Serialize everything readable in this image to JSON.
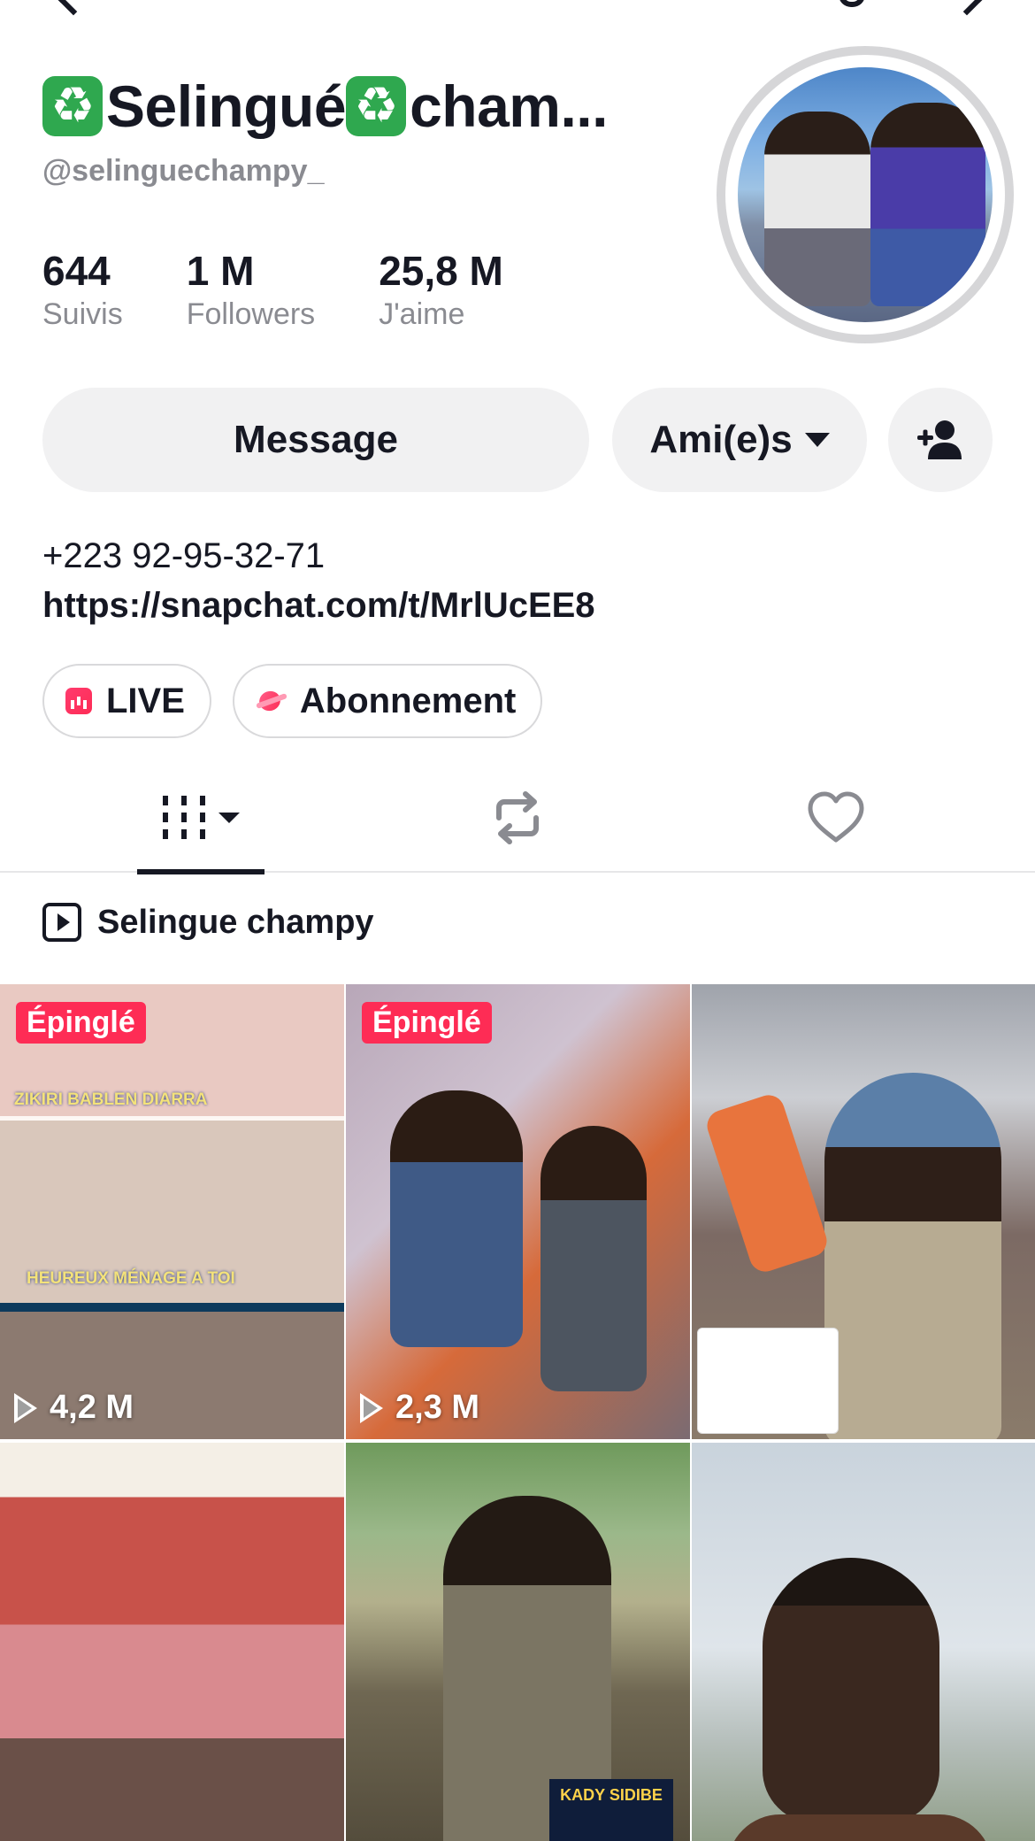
{
  "profile": {
    "display_name": "Selingué",
    "display_name_suffix": " cham...",
    "emoji": "♻️",
    "username": "@selinguechampy_",
    "stats": [
      {
        "value": "644",
        "label": "Suivis"
      },
      {
        "value": "1 M",
        "label": "Followers"
      },
      {
        "value": "25,8 M",
        "label": "J'aime"
      }
    ],
    "bio_phone": "+223 92-95-32-71",
    "bio_link": "https://snapchat.com/t/MrlUcEE8"
  },
  "actions": {
    "message_label": "Message",
    "friends_label": "Ami(e)s",
    "add_friend_icon": "add-user-icon"
  },
  "chips": {
    "live_label": "LIVE",
    "subscription_label": "Abonnement"
  },
  "tabs": {
    "videos_icon": "grid-icon",
    "repost_icon": "repost-icon",
    "liked_icon": "heart-icon"
  },
  "playlist": {
    "label": "Selingue champy"
  },
  "videos": [
    {
      "pinned_label": "Épinglé",
      "views": "4,2 M",
      "caption_a": "ZIKIRI BABLEN DIARRA",
      "caption_b": "HEUREUX MÉNAGE A TOI"
    },
    {
      "pinned_label": "Épinglé",
      "views": "2,3 M"
    },
    {},
    {},
    {
      "poster_text": "KADY SIDIBE"
    },
    {}
  ],
  "colors": {
    "accent": "#fe2c55",
    "text": "#161823",
    "secondary_text": "#8a8b91",
    "button_bg": "#f1f1f2"
  }
}
